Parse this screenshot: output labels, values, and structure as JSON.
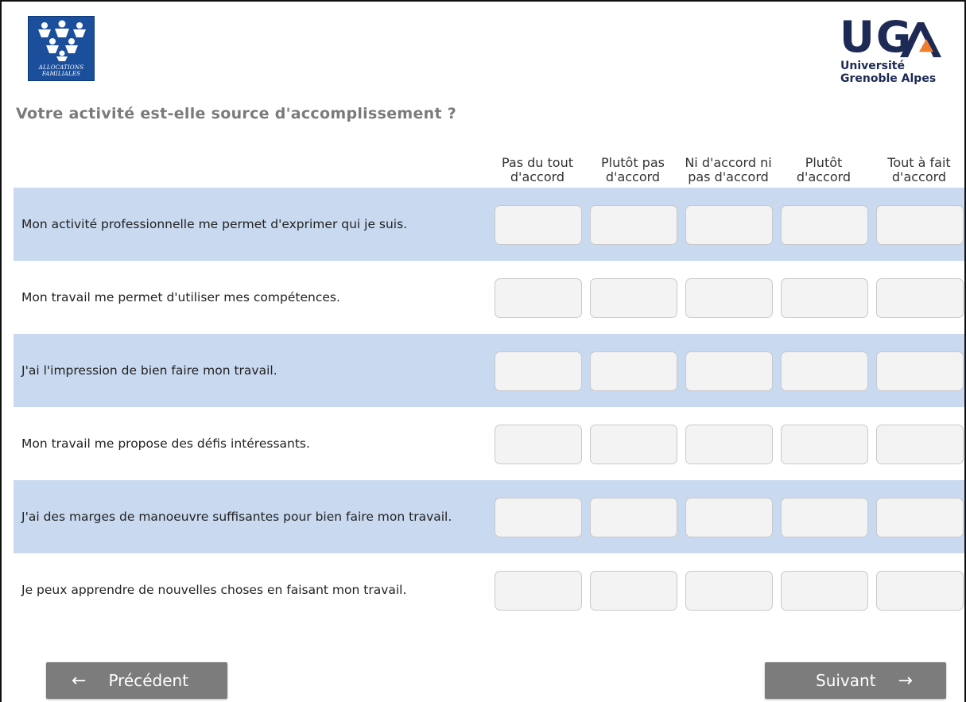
{
  "logos": {
    "caf": {
      "text_line1": "ALLOCATIONS",
      "text_line2": "FAMILIALES",
      "color": "#1b4f9c"
    },
    "uga": {
      "mark": "UG",
      "line1": "Université",
      "line2": "Grenoble Alpes",
      "color": "#1c2a55",
      "accent": "#ef7d2f"
    }
  },
  "question": {
    "title": "Votre activité est-elle source d'accomplissement ?"
  },
  "columns": [
    "Pas du tout d'accord",
    "Plutôt pas d'accord",
    "Ni d'accord ni pas d'accord",
    "Plutôt d'accord",
    "Tout à fait d'accord"
  ],
  "rows": [
    "Mon activité professionnelle me permet d'exprimer qui je suis.",
    "Mon travail me permet d'utiliser mes compétences.",
    "J'ai l'impression de bien faire mon travail.",
    "Mon travail me propose des défis intéressants.",
    "J'ai des marges de manoeuvre suffisantes pour bien faire mon travail.",
    "Je peux apprendre de nouvelles choses en faisant mon travail."
  ],
  "navigation": {
    "previous_label": "Précédent",
    "next_label": "Suivant",
    "previous_icon": "arrow-left-icon",
    "next_icon": "arrow-right-icon"
  },
  "colors": {
    "row_shade": "#c8d9f0",
    "button": "#7c7c7c",
    "title": "#7a7a7a"
  }
}
